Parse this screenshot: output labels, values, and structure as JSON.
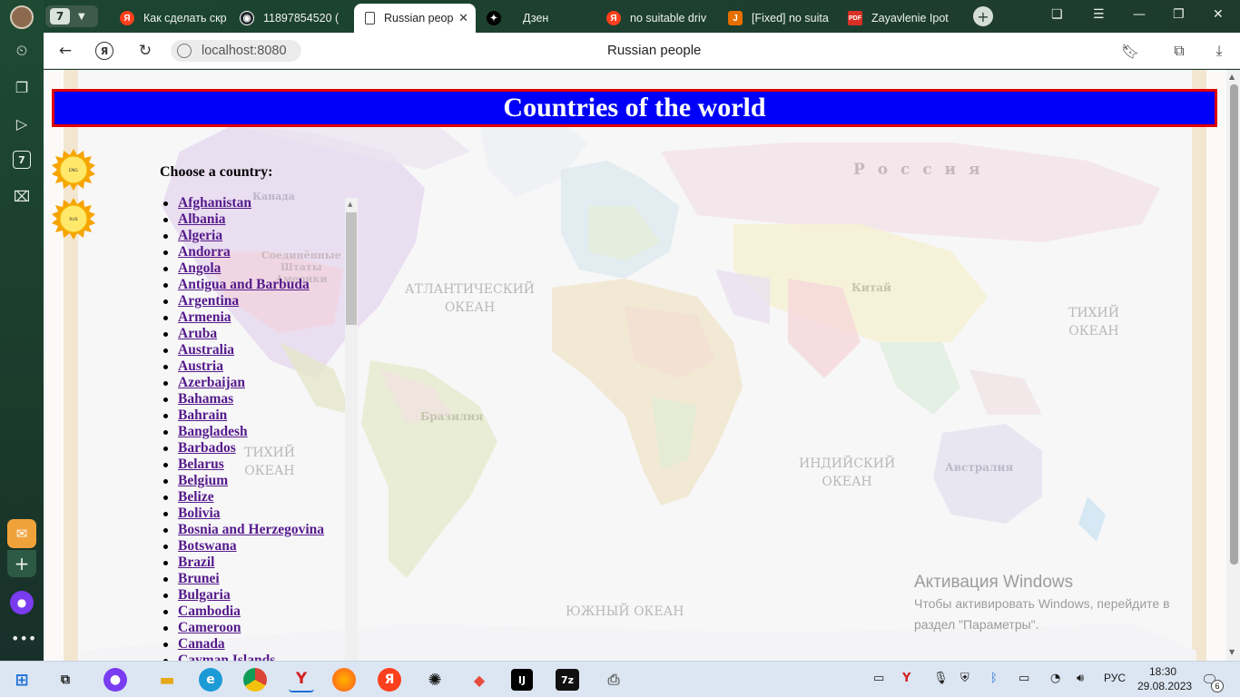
{
  "browser": {
    "tab_count": "7",
    "tabs": [
      {
        "label": "Как сделать скр",
        "favicon": "yandex-icon",
        "color": "#fc3f1d"
      },
      {
        "label": "11897854520 (",
        "favicon": "github-icon",
        "color": "#24292e"
      },
      {
        "label": "Russian peop",
        "favicon": "page-icon",
        "active": true
      },
      {
        "label": "Дзен",
        "favicon": "zen-icon",
        "color": "#000000"
      },
      {
        "label": "no suitable driv",
        "favicon": "yandex-icon",
        "color": "#fc3f1d"
      },
      {
        "label": "[Fixed] no suita",
        "favicon": "java-icon",
        "color": "#e76f00"
      },
      {
        "label": "Zayavlenie Ipot",
        "favicon": "pdf-icon",
        "color": "#d93025"
      }
    ],
    "address": "localhost:8080",
    "page_title": "Russian people"
  },
  "page": {
    "banner_title": "Countries of the world",
    "lang_buttons": [
      {
        "label": "ENG"
      },
      {
        "label": "RUS"
      }
    ],
    "choose_label": "Choose a country:",
    "countries": [
      "Afghanistan",
      "Albania",
      "Algeria",
      "Andorra",
      "Angola",
      "Antigua and Barbuda",
      "Argentina",
      "Armenia",
      "Aruba",
      "Australia",
      "Austria",
      "Azerbaijan",
      "Bahamas",
      "Bahrain",
      "Bangladesh",
      "Barbados",
      "Belarus",
      "Belgium",
      "Belize",
      "Bolivia",
      "Bosnia and Herzegovina",
      "Botswana",
      "Brazil",
      "Brunei",
      "Bulgaria",
      "Cambodia",
      "Cameroon",
      "Canada",
      "Cayman Islands"
    ],
    "map_labels": {
      "russia": "Р о с с и я",
      "atlantic": "АТЛАНТИЧЕСКИЙ\nОКЕАН",
      "pacific_right": "ТИХИЙ\nОКЕАН",
      "pacific_left": "ТИХИЙ\nОКЕАН",
      "indian": "ИНДИЙСКИЙ\nОКЕАН",
      "southern": "ЮЖНЫЙ ОКЕАН",
      "china": "Китай",
      "brazil": "Бразилия",
      "australia": "Австралия",
      "canada": "Канада",
      "usa": "Соединённые\nШтаты\nАмерики"
    }
  },
  "activation": {
    "title": "Активация Windows",
    "line1": "Чтобы активировать Windows, перейдите в",
    "line2": "раздел \"Параметры\"."
  },
  "taskbar": {
    "language": "РУС",
    "time": "18:30",
    "date": "29.08.2023",
    "notifications": "6"
  }
}
